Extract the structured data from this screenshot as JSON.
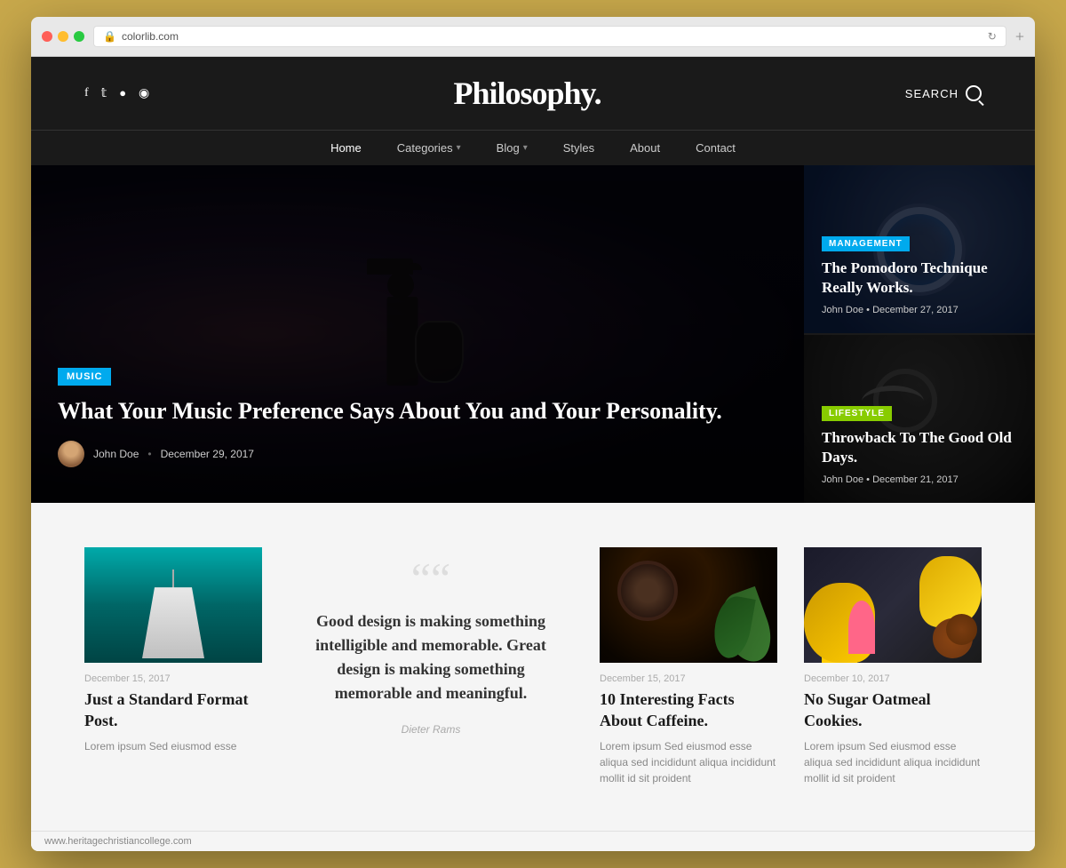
{
  "browser": {
    "url": "colorlib.com",
    "refresh_icon": "↻",
    "add_tab_icon": "+"
  },
  "header": {
    "title": "Philosophy.",
    "search_label": "SEARCH",
    "social_icons": [
      "f",
      "𝕋",
      "⊡",
      "⊕"
    ]
  },
  "nav": {
    "items": [
      {
        "label": "Home",
        "active": true,
        "has_arrow": false
      },
      {
        "label": "Categories",
        "active": false,
        "has_arrow": true
      },
      {
        "label": "Blog",
        "active": false,
        "has_arrow": true
      },
      {
        "label": "Styles",
        "active": false,
        "has_arrow": false
      },
      {
        "label": "About",
        "active": false,
        "has_arrow": false
      },
      {
        "label": "Contact",
        "active": false,
        "has_arrow": false
      }
    ]
  },
  "hero": {
    "main": {
      "badge": "MUSIC",
      "title": "What Your Music Preference Says About You and Your Personality.",
      "author": "John Doe",
      "date": "December 29, 2017"
    },
    "card1": {
      "badge": "MANAGEMENT",
      "title": "The Pomodoro Technique Really Works.",
      "author": "John Doe",
      "date": "December 27, 2017"
    },
    "card2": {
      "badge": "LIFESTYLE",
      "title": "Throwback To The Good Old Days.",
      "author": "John Doe",
      "date": "December 21, 2017"
    }
  },
  "content": {
    "post1": {
      "date": "December 15, 2017",
      "title": "Just a Standard Format Post.",
      "excerpt": "Lorem ipsum Sed eiusmod esse"
    },
    "quote": {
      "marks": "““",
      "text": "Good design is making something intelligible and memorable. Great design is making something memorable and meaningful.",
      "author": "Dieter Rams"
    },
    "post2": {
      "date": "December 15, 2017",
      "title": "10 Interesting Facts About Caffeine.",
      "excerpt": "Lorem ipsum Sed eiusmod esse aliqua sed incididunt aliqua incididunt mollit id sit proident"
    },
    "post3": {
      "date": "December 10, 2017",
      "title": "No Sugar Oatmeal Cookies.",
      "excerpt": "Lorem ipsum Sed eiusmod esse aliqua sed incididunt aliqua incididunt mollit id sit proident"
    }
  },
  "status_bar": {
    "url": "www.heritagechristiancollege.com"
  }
}
